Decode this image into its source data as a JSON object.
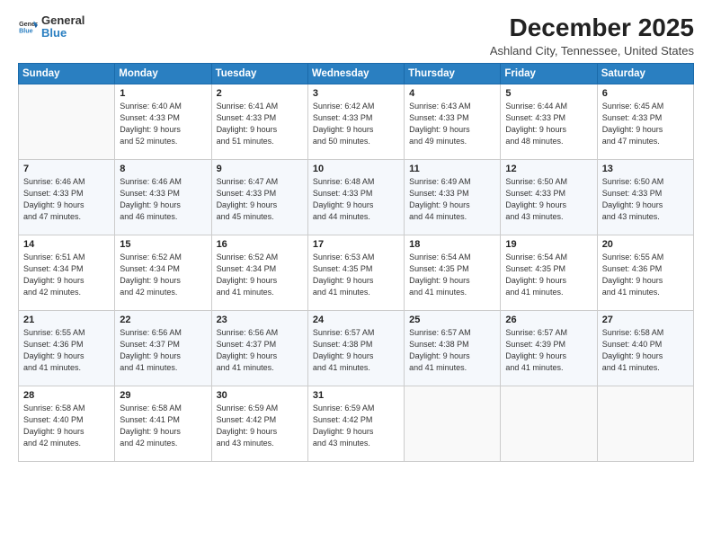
{
  "logo": {
    "general": "General",
    "blue": "Blue"
  },
  "title": "December 2025",
  "subtitle": "Ashland City, Tennessee, United States",
  "days_of_week": [
    "Sunday",
    "Monday",
    "Tuesday",
    "Wednesday",
    "Thursday",
    "Friday",
    "Saturday"
  ],
  "weeks": [
    [
      {
        "day": "",
        "info": ""
      },
      {
        "day": "1",
        "info": "Sunrise: 6:40 AM\nSunset: 4:33 PM\nDaylight: 9 hours\nand 52 minutes."
      },
      {
        "day": "2",
        "info": "Sunrise: 6:41 AM\nSunset: 4:33 PM\nDaylight: 9 hours\nand 51 minutes."
      },
      {
        "day": "3",
        "info": "Sunrise: 6:42 AM\nSunset: 4:33 PM\nDaylight: 9 hours\nand 50 minutes."
      },
      {
        "day": "4",
        "info": "Sunrise: 6:43 AM\nSunset: 4:33 PM\nDaylight: 9 hours\nand 49 minutes."
      },
      {
        "day": "5",
        "info": "Sunrise: 6:44 AM\nSunset: 4:33 PM\nDaylight: 9 hours\nand 48 minutes."
      },
      {
        "day": "6",
        "info": "Sunrise: 6:45 AM\nSunset: 4:33 PM\nDaylight: 9 hours\nand 47 minutes."
      }
    ],
    [
      {
        "day": "7",
        "info": "Sunrise: 6:46 AM\nSunset: 4:33 PM\nDaylight: 9 hours\nand 47 minutes."
      },
      {
        "day": "8",
        "info": "Sunrise: 6:46 AM\nSunset: 4:33 PM\nDaylight: 9 hours\nand 46 minutes."
      },
      {
        "day": "9",
        "info": "Sunrise: 6:47 AM\nSunset: 4:33 PM\nDaylight: 9 hours\nand 45 minutes."
      },
      {
        "day": "10",
        "info": "Sunrise: 6:48 AM\nSunset: 4:33 PM\nDaylight: 9 hours\nand 44 minutes."
      },
      {
        "day": "11",
        "info": "Sunrise: 6:49 AM\nSunset: 4:33 PM\nDaylight: 9 hours\nand 44 minutes."
      },
      {
        "day": "12",
        "info": "Sunrise: 6:50 AM\nSunset: 4:33 PM\nDaylight: 9 hours\nand 43 minutes."
      },
      {
        "day": "13",
        "info": "Sunrise: 6:50 AM\nSunset: 4:33 PM\nDaylight: 9 hours\nand 43 minutes."
      }
    ],
    [
      {
        "day": "14",
        "info": "Sunrise: 6:51 AM\nSunset: 4:34 PM\nDaylight: 9 hours\nand 42 minutes."
      },
      {
        "day": "15",
        "info": "Sunrise: 6:52 AM\nSunset: 4:34 PM\nDaylight: 9 hours\nand 42 minutes."
      },
      {
        "day": "16",
        "info": "Sunrise: 6:52 AM\nSunset: 4:34 PM\nDaylight: 9 hours\nand 41 minutes."
      },
      {
        "day": "17",
        "info": "Sunrise: 6:53 AM\nSunset: 4:35 PM\nDaylight: 9 hours\nand 41 minutes."
      },
      {
        "day": "18",
        "info": "Sunrise: 6:54 AM\nSunset: 4:35 PM\nDaylight: 9 hours\nand 41 minutes."
      },
      {
        "day": "19",
        "info": "Sunrise: 6:54 AM\nSunset: 4:35 PM\nDaylight: 9 hours\nand 41 minutes."
      },
      {
        "day": "20",
        "info": "Sunrise: 6:55 AM\nSunset: 4:36 PM\nDaylight: 9 hours\nand 41 minutes."
      }
    ],
    [
      {
        "day": "21",
        "info": "Sunrise: 6:55 AM\nSunset: 4:36 PM\nDaylight: 9 hours\nand 41 minutes."
      },
      {
        "day": "22",
        "info": "Sunrise: 6:56 AM\nSunset: 4:37 PM\nDaylight: 9 hours\nand 41 minutes."
      },
      {
        "day": "23",
        "info": "Sunrise: 6:56 AM\nSunset: 4:37 PM\nDaylight: 9 hours\nand 41 minutes."
      },
      {
        "day": "24",
        "info": "Sunrise: 6:57 AM\nSunset: 4:38 PM\nDaylight: 9 hours\nand 41 minutes."
      },
      {
        "day": "25",
        "info": "Sunrise: 6:57 AM\nSunset: 4:38 PM\nDaylight: 9 hours\nand 41 minutes."
      },
      {
        "day": "26",
        "info": "Sunrise: 6:57 AM\nSunset: 4:39 PM\nDaylight: 9 hours\nand 41 minutes."
      },
      {
        "day": "27",
        "info": "Sunrise: 6:58 AM\nSunset: 4:40 PM\nDaylight: 9 hours\nand 41 minutes."
      }
    ],
    [
      {
        "day": "28",
        "info": "Sunrise: 6:58 AM\nSunset: 4:40 PM\nDaylight: 9 hours\nand 42 minutes."
      },
      {
        "day": "29",
        "info": "Sunrise: 6:58 AM\nSunset: 4:41 PM\nDaylight: 9 hours\nand 42 minutes."
      },
      {
        "day": "30",
        "info": "Sunrise: 6:59 AM\nSunset: 4:42 PM\nDaylight: 9 hours\nand 43 minutes."
      },
      {
        "day": "31",
        "info": "Sunrise: 6:59 AM\nSunset: 4:42 PM\nDaylight: 9 hours\nand 43 minutes."
      },
      {
        "day": "",
        "info": ""
      },
      {
        "day": "",
        "info": ""
      },
      {
        "day": "",
        "info": ""
      }
    ]
  ]
}
